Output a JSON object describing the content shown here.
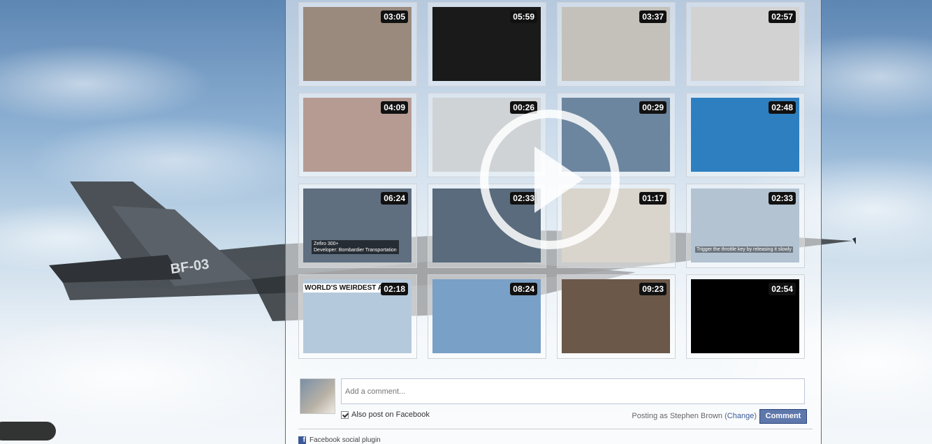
{
  "videos": [
    {
      "duration": "03:05",
      "icon": "model-jet-thumbnail",
      "bg": "#9a8a7d"
    },
    {
      "duration": "05:59",
      "icon": "ted-speaker-thumbnail",
      "bg": "#1a1a1a"
    },
    {
      "duration": "03:37",
      "icon": "green-jet-model-thumbnail",
      "bg": "#c4c1ba"
    },
    {
      "duration": "02:57",
      "icon": "helicopter-thumbnail",
      "bg": "#d2d2d2"
    },
    {
      "duration": "04:09",
      "icon": "rc-plane-thumbnail",
      "bg": "#b69b93"
    },
    {
      "duration": "00:26",
      "icon": "stealth-render-thumbnail",
      "bg": "#cfd3d6"
    },
    {
      "duration": "00:29",
      "icon": "fighter-landscape-thumbnail",
      "bg": "#6d869f"
    },
    {
      "duration": "02:48",
      "icon": "klm-airship-thumbnail",
      "bg": "#2d7fc0"
    },
    {
      "duration": "06:24",
      "icon": "zefiro-train-thumbnail",
      "bg": "#5f6f80"
    },
    {
      "duration": "02:33",
      "icon": "aircraft-carrier-thumbnail",
      "bg": "#596b7c"
    },
    {
      "duration": "01:17",
      "icon": "desert-plane-thumbnail",
      "bg": "#d9d4cc"
    },
    {
      "duration": "02:33",
      "icon": "rc-airliner-thumbnail",
      "bg": "#b3c3d2"
    },
    {
      "duration": "02:18",
      "icon": "weirdest-airplane-thumbnail",
      "bg": "#b5c9dc"
    },
    {
      "duration": "08:24",
      "icon": "airliner-village-thumbnail",
      "bg": "#79a0c6"
    },
    {
      "duration": "09:23",
      "icon": "lecture-hall-thumbnail",
      "bg": "#6c5849"
    },
    {
      "duration": "02:54",
      "icon": "red-fluid-thumbnail",
      "bg": "#000000"
    }
  ],
  "overlay_texts": {
    "train_caption_1": "Zefiro 300+",
    "train_caption_2": "Developer: Bombardier Transportation",
    "weird_caption": "WORLD'S WEIRDEST AIRP",
    "rc_caption": "Trigger the throttle key by releasing it slowly"
  },
  "jet_tail_label": "BF-03",
  "comment": {
    "placeholder": "Add a comment...",
    "also_post_label": "Also post on Facebook",
    "posting_as_prefix": "Posting as Stephen Brown",
    "change_link": "Change",
    "button_label": "Comment"
  },
  "footer": {
    "plugin_label": "Facebook social plugin"
  },
  "colors": {
    "fb_blue": "#3b5998",
    "button_blue": "#5f78ab"
  }
}
